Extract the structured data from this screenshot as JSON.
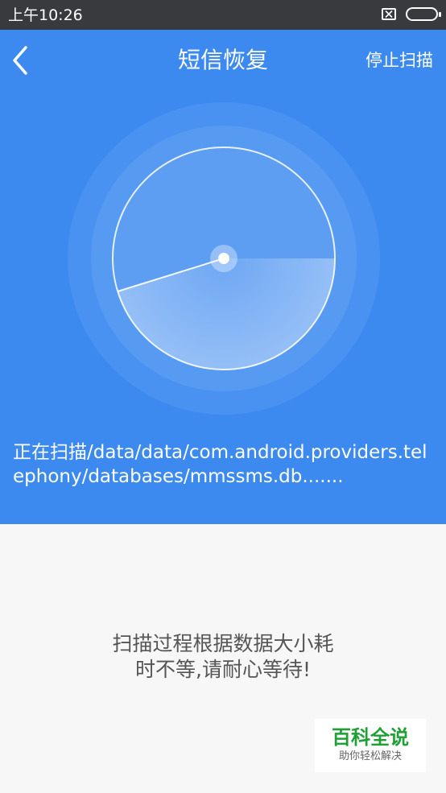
{
  "status_bar": {
    "time": "上午10:26",
    "icons": [
      "notification-cleared-icon",
      "battery-icon"
    ]
  },
  "header": {
    "title": "短信恢复",
    "stop_label": "停止扫描",
    "back_icon": "back-chevron-icon"
  },
  "scan": {
    "path_text": "正在扫描/data/data/com.android.providers.telephony/databases/mmssms.db......."
  },
  "hint": {
    "line1": "扫描过程根据数据大小耗",
    "line2": "时不等,请耐心等待!"
  },
  "watermark": {
    "title": "百科全说",
    "subtitle": "助你轻松解决"
  },
  "colors": {
    "header_bg": "#3c8af0",
    "status_bg": "#383a3d",
    "body_bg": "#f7f7f7",
    "watermark_green": "#1ea034"
  }
}
